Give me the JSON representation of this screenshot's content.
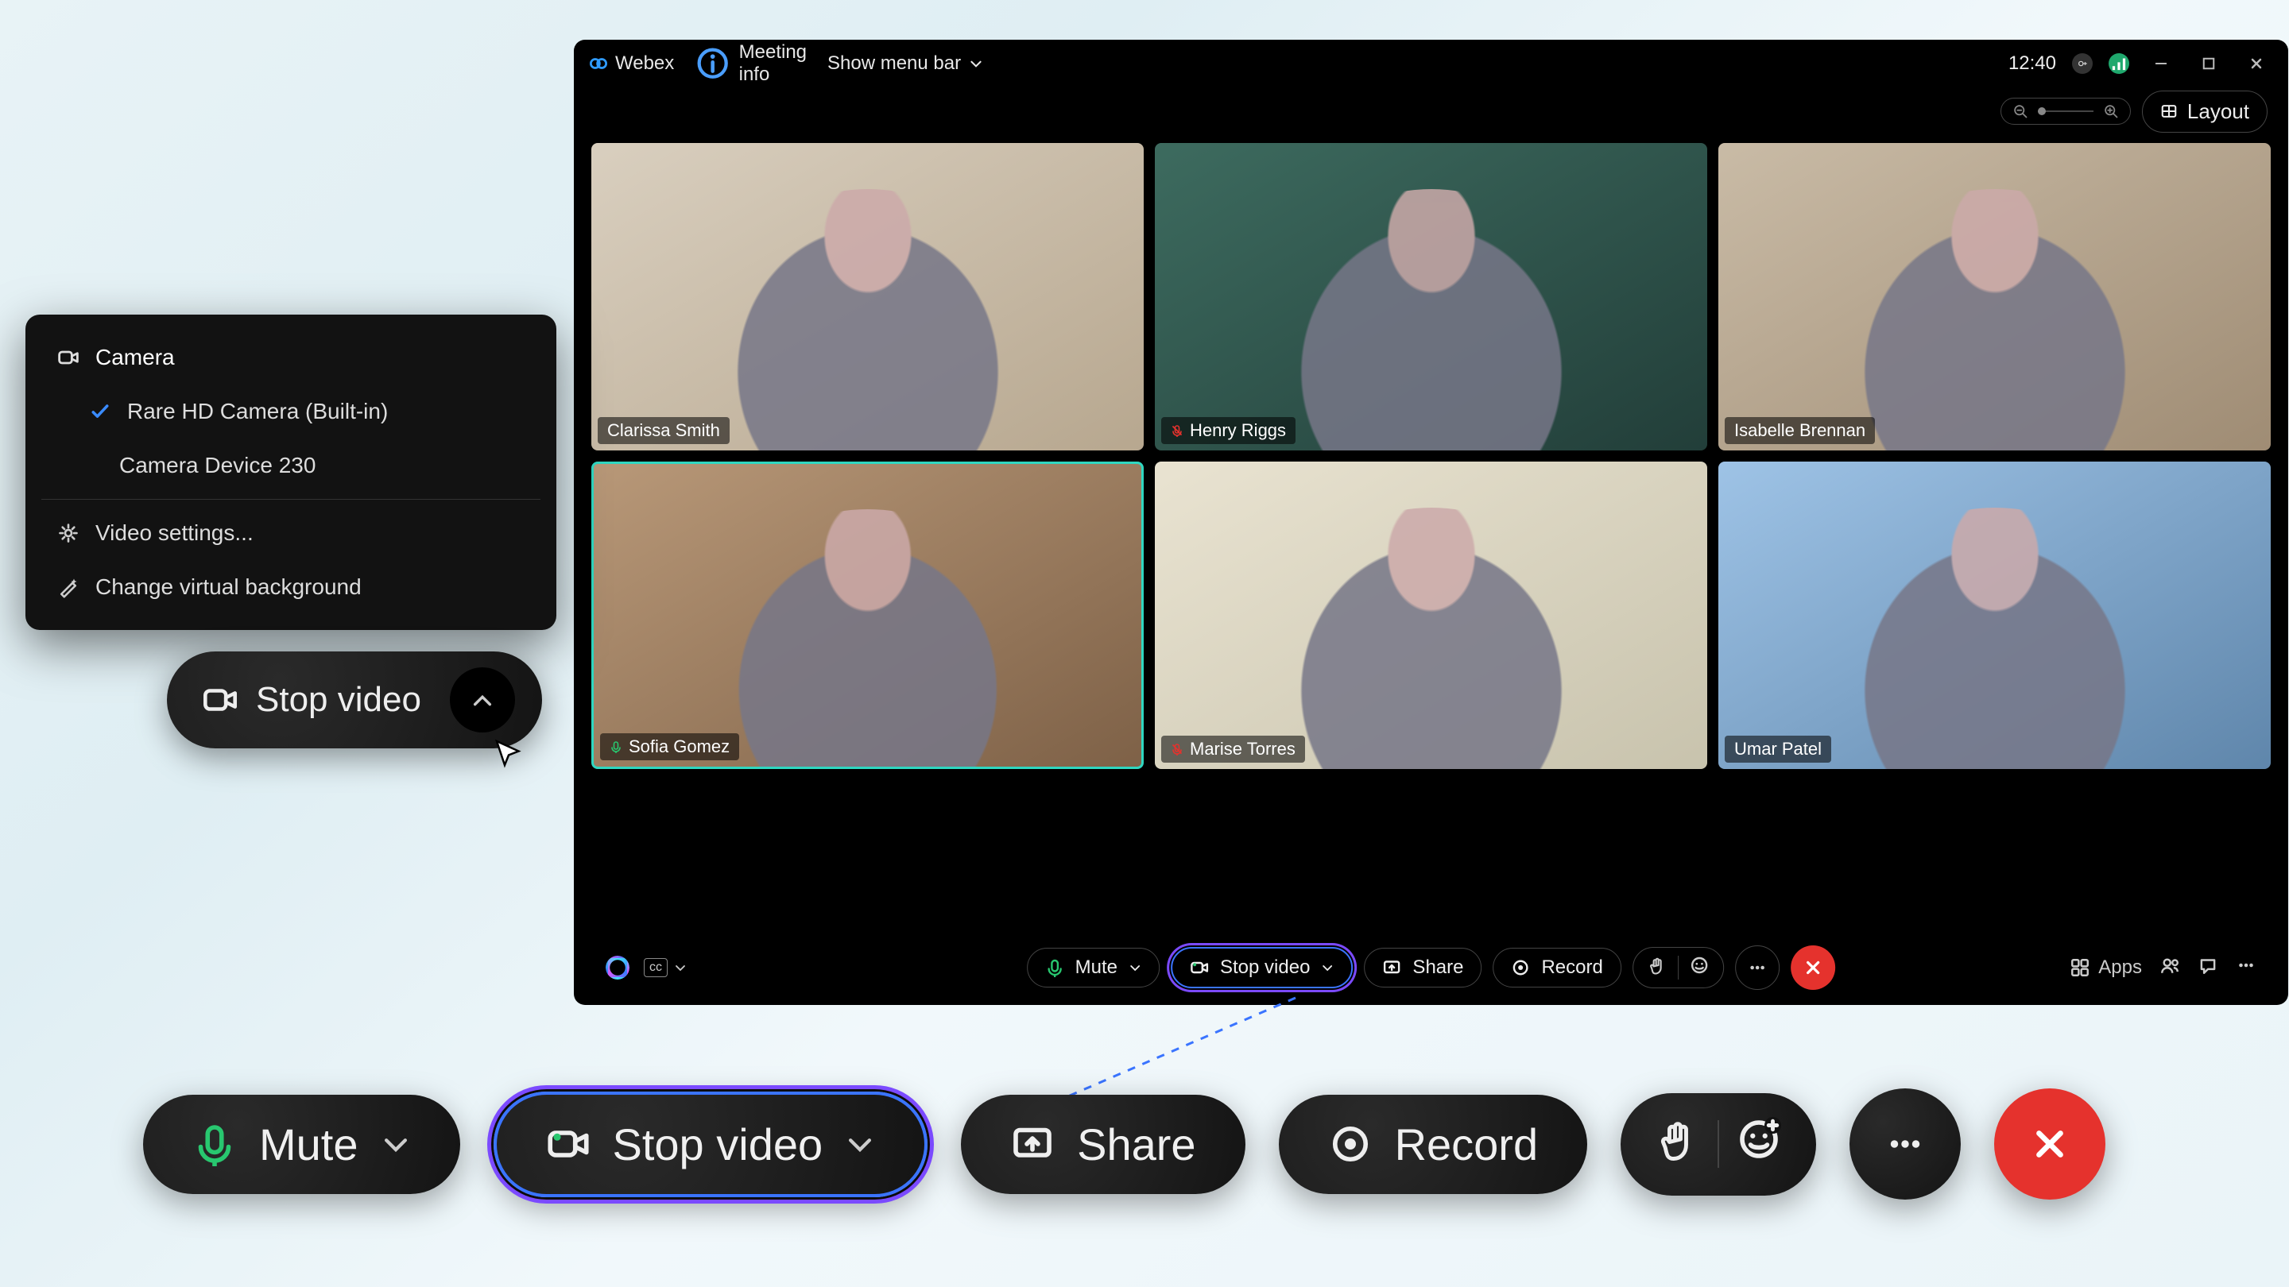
{
  "titlebar": {
    "brand": "Webex",
    "meeting_info": "Meeting info",
    "show_menu_bar": "Show menu bar",
    "clock": "12:40"
  },
  "subbar": {
    "layout": "Layout"
  },
  "participants": [
    {
      "name": "Clarissa Smith",
      "muted": false,
      "active": false
    },
    {
      "name": "Henry Riggs",
      "muted": true,
      "active": false
    },
    {
      "name": "Isabelle Brennan",
      "muted": false,
      "active": false
    },
    {
      "name": "Sofia Gomez",
      "muted": false,
      "active": true
    },
    {
      "name": "Marise Torres",
      "muted": true,
      "active": false
    },
    {
      "name": "Umar Patel",
      "muted": false,
      "active": false
    }
  ],
  "winToolbar": {
    "mute": "Mute",
    "stop_video": "Stop video",
    "share": "Share",
    "record": "Record",
    "apps": "Apps"
  },
  "camMenu": {
    "section": "Camera",
    "options": [
      "Rare HD Camera (Built-in)",
      "Camera Device 230"
    ],
    "settings": "Video settings...",
    "virtual_bg": "Change virtual background"
  },
  "callout": {
    "stop_video": "Stop video"
  },
  "bigBar": {
    "mute": "Mute",
    "stop_video": "Stop video",
    "share": "Share",
    "record": "Record"
  }
}
